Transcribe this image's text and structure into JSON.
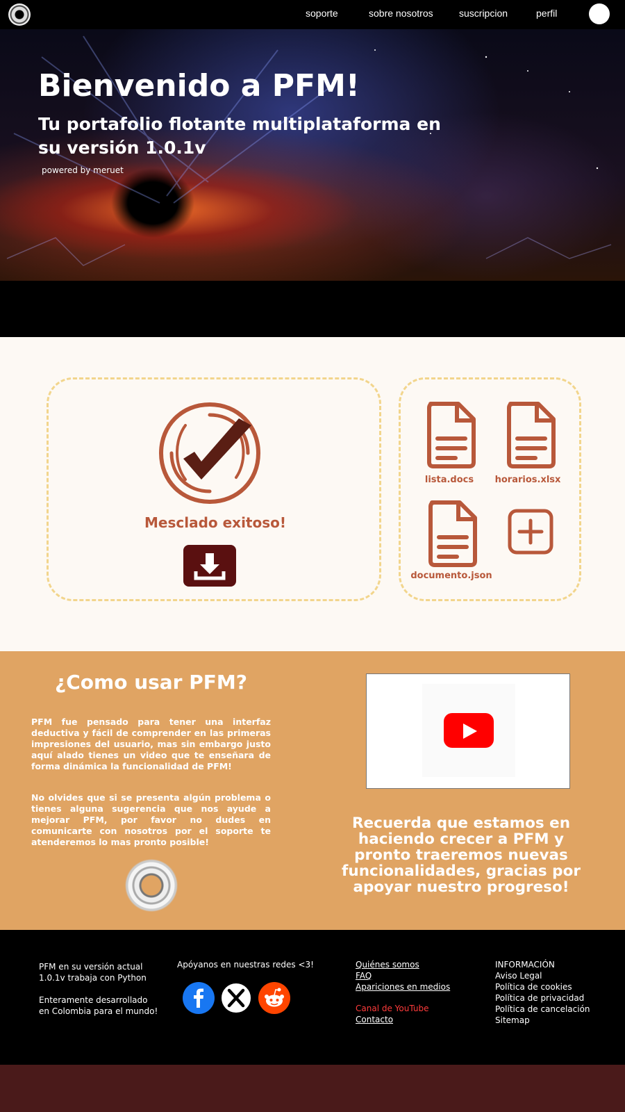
{
  "nav": {
    "links": [
      "soporte",
      "sobre nosotros",
      "suscripcion",
      "perfil"
    ]
  },
  "hero": {
    "title": "Bienvenido a PFM!",
    "subtitle": "Tu portafolio flotante multiplataforma en su versión 1.0.1v",
    "powered": "powered by meruet"
  },
  "merge": {
    "status": "Mesclado exitoso!",
    "files": [
      "lista.docs",
      "horarios.xlsx",
      "documento.json"
    ]
  },
  "howto": {
    "title": "¿Como usar PFM?",
    "p1": "PFM fue pensado para tener una interfaz deductiva y fácil de comprender en las primeras impresiones del usuario, mas sin embargo justo aquí alado tienes un video que te enseñara de forma dinámica la funcionalidad de PFM!",
    "p2": "No olvides que si se presenta algún problema o tienes alguna sugerencia que nos ayude a mejorar PFM, por favor no dudes en comunicarte con nosotros por el soporte te atenderemos lo mas pronto posible!",
    "remember": "Recuerda que estamos en haciendo crecer a PFM y pronto traeremos nuevas funcionalidades, gracias por apoyar nuestro progreso!"
  },
  "footer": {
    "about": [
      "PFM en su versión actual",
      "1.0.1v trabaja con Python",
      "Enteramente desarrollado",
      "en Colombia para el mundo!"
    ],
    "support": "Apóyanos en nuestras redes <3!",
    "links": [
      "Quiénes somos",
      "FAQ",
      "Apariciones en medios",
      "Canal de YouTube",
      "Contacto"
    ],
    "info": [
      "INFORMACIÓN",
      "Aviso Legal",
      "Política de cookies",
      "Política de privacidad",
      "Política de cancelación",
      "Sitemap"
    ]
  },
  "colors": {
    "accent": "#b8583a",
    "howto_bg": "#e0a463",
    "dashed": "#f2d58c",
    "download_bg": "#5a1010"
  }
}
